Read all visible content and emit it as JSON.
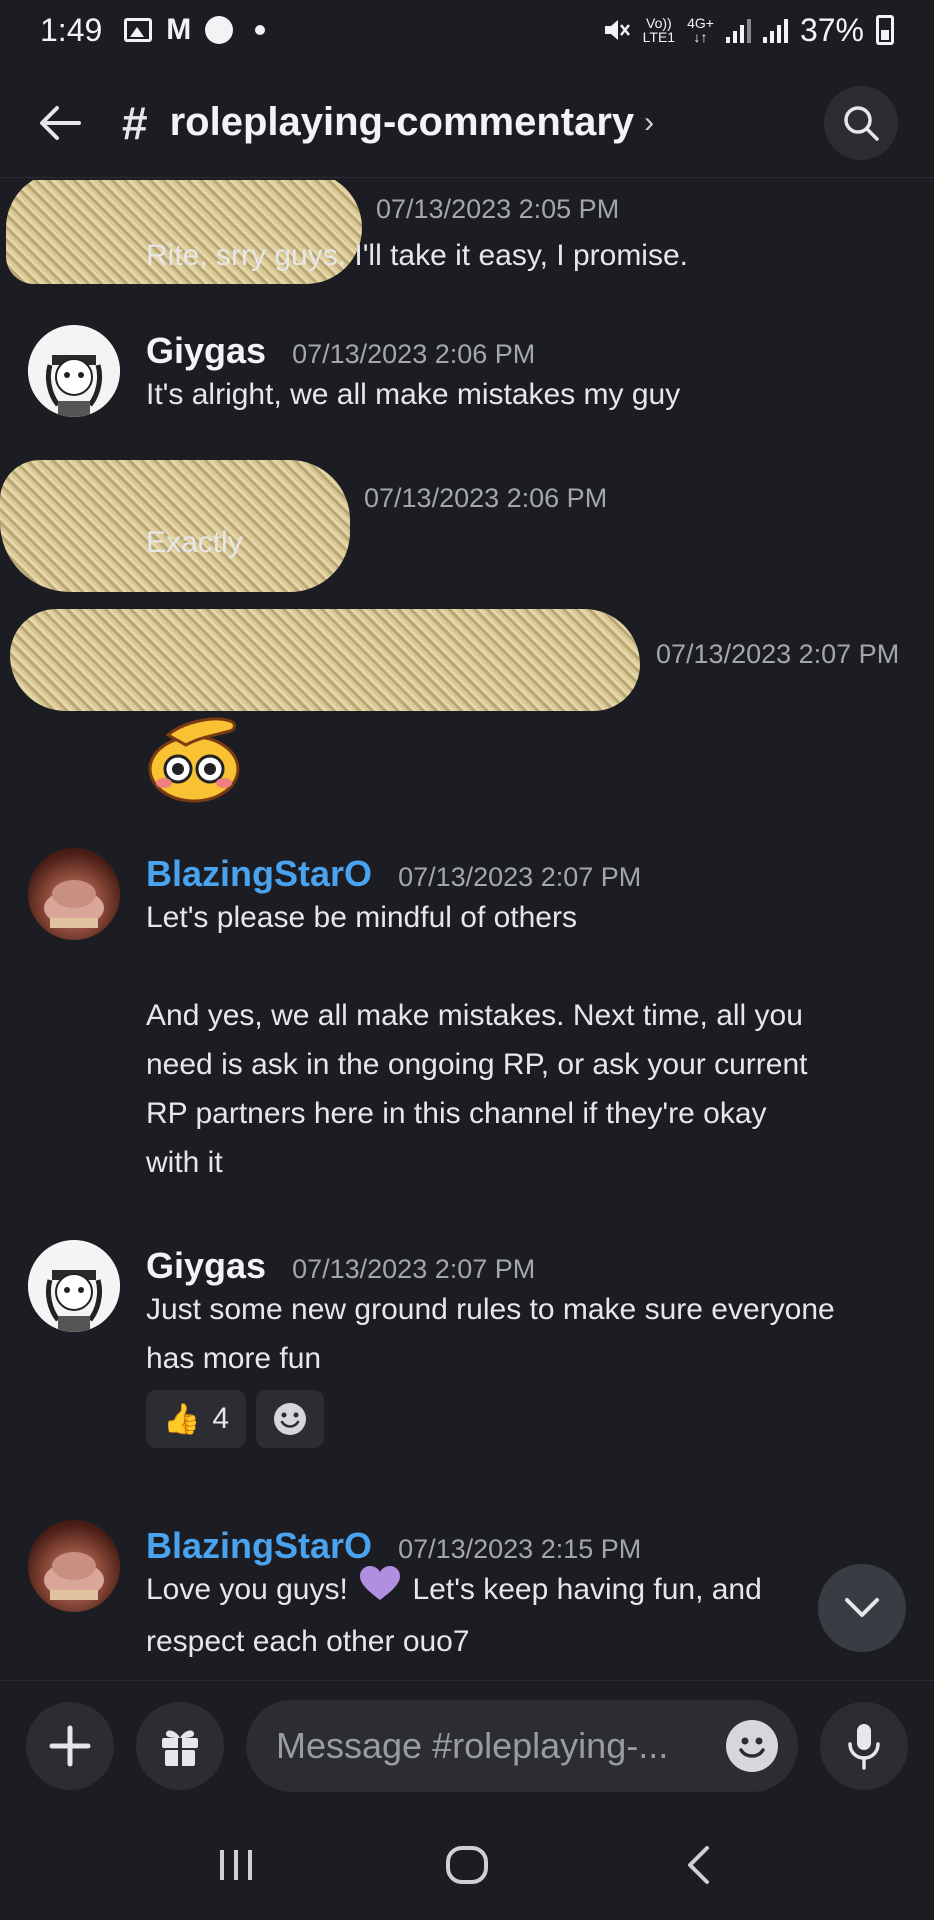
{
  "status_bar": {
    "time": "1:49",
    "mail_letter": "M",
    "volte": "Vo))",
    "lte": "LTE1",
    "network": "4G+",
    "battery": "37%"
  },
  "header": {
    "hash": "#",
    "channel": "roleplaying-commentary",
    "chevron": "›"
  },
  "messages": [
    {
      "author": "",
      "timestamp": "07/13/2023 2:05 PM",
      "text": "Rite, srry guys. I'll take it easy, I promise."
    },
    {
      "author": "Giygas",
      "timestamp": "07/13/2023 2:06 PM",
      "text": "It's alright, we all make mistakes my guy"
    },
    {
      "author": "",
      "timestamp": "07/13/2023 2:06 PM",
      "text": "Exactly"
    },
    {
      "author": "",
      "timestamp": "07/13/2023 2:07 PM",
      "text": ""
    },
    {
      "author": "BlazingStarO",
      "timestamp": "07/13/2023 2:07 PM",
      "lines": [
        "Let's please be mindful of others",
        "",
        "And yes, we all make mistakes. Next time, all you",
        "need is ask in the ongoing RP, or ask your current",
        "RP partners here in this channel if they're okay",
        "with it"
      ]
    },
    {
      "author": "Giygas",
      "timestamp": "07/13/2023 2:07 PM",
      "lines": [
        "Just some new ground rules to make sure everyone",
        "has more fun"
      ],
      "reaction_count": "4"
    },
    {
      "author": "BlazingStarO",
      "timestamp": "07/13/2023 2:15 PM",
      "line1_a": "Love you guys!",
      "line1_b": "Let's keep having fun, and",
      "line2": "respect each other ouo7"
    }
  ],
  "composer": {
    "placeholder": "Message #roleplaying-..."
  },
  "colors": {
    "background": "#1c1d23",
    "author_blue": "#4aa3ee",
    "timestamp": "#a3a6ad",
    "pill": "#2b2d33"
  }
}
